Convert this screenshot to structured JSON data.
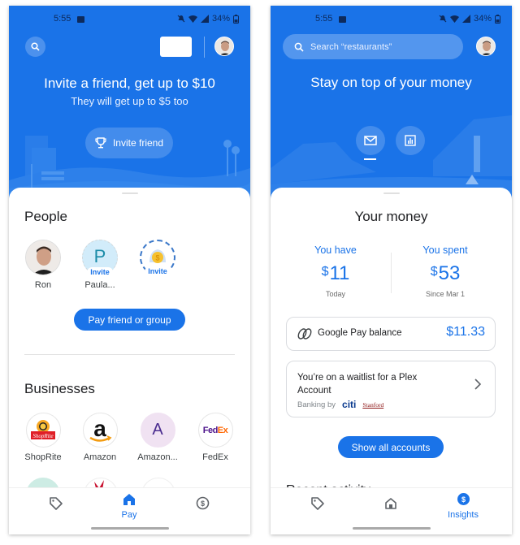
{
  "status_bar": {
    "time": "5:55",
    "battery": "34%"
  },
  "left_screen": {
    "hero": {
      "title": "Invite a friend, get up to $10",
      "subtitle": "They will get up to $5 too",
      "invite_button_label": "Invite friend"
    },
    "people": {
      "title": "People",
      "items": [
        {
          "name": "Ron",
          "type": "photo"
        },
        {
          "name": "Paula...",
          "initial": "P",
          "badge": "Invite"
        },
        {
          "name": "",
          "type": "reward",
          "badge": "Invite"
        }
      ],
      "pay_button_label": "Pay friend or group"
    },
    "businesses": {
      "title": "Businesses",
      "items": [
        {
          "name": "ShopRite"
        },
        {
          "name": "Amazon"
        },
        {
          "name": "Amazon...",
          "initial": "A"
        },
        {
          "name": "FedEx",
          "logo_text_1": "Fed",
          "logo_text_2": "Ex"
        }
      ]
    },
    "bottom_nav": {
      "items": [
        {
          "icon": "tag-icon",
          "label": ""
        },
        {
          "icon": "home-icon",
          "label": "Pay",
          "active": true
        },
        {
          "icon": "dollar-circle-icon",
          "label": ""
        }
      ]
    }
  },
  "right_screen": {
    "search_placeholder": "Search “restaurants”",
    "hero": {
      "title": "Stay on top of your money"
    },
    "your_money": {
      "title": "Your money",
      "have": {
        "label": "You have",
        "currency": "$",
        "amount": "11",
        "sub": "Today"
      },
      "spent": {
        "label": "You spent",
        "currency": "$",
        "amount": "53",
        "sub": "Since Mar 1"
      }
    },
    "gpay_balance": {
      "label": "Google Pay balance",
      "amount": "$11.33"
    },
    "plex": {
      "text": "You’re on a waitlist for a Plex Account",
      "banking_by": "Banking by",
      "bank1": "citi",
      "bank2": "Stanford"
    },
    "show_all_label": "Show all accounts",
    "recent_activity": "Recent activity",
    "bottom_nav": {
      "items": [
        {
          "icon": "tag-icon",
          "label": ""
        },
        {
          "icon": "home-icon",
          "label": ""
        },
        {
          "icon": "insights-icon",
          "label": "Insights",
          "active": true
        }
      ]
    }
  },
  "colors": {
    "brand_blue": "#1a73e8",
    "text_dark": "#202124",
    "text_grey": "#6b6b6b"
  }
}
